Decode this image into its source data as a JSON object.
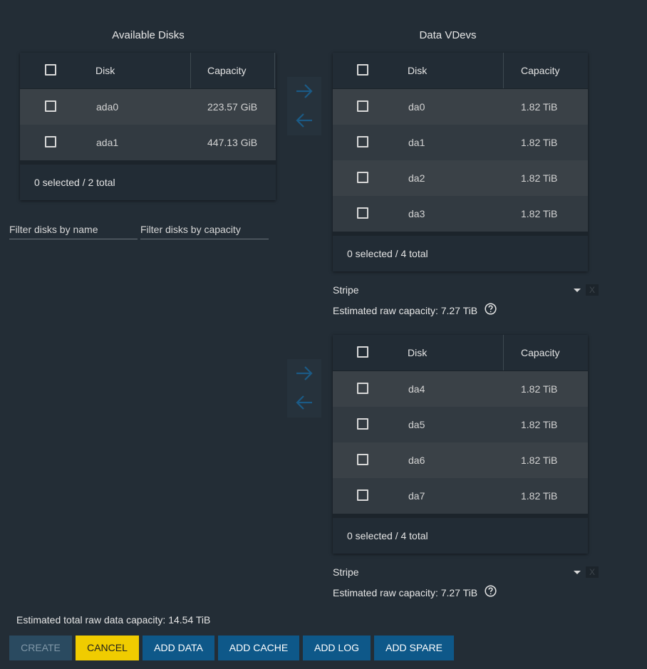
{
  "available": {
    "title": "Available Disks",
    "headers": {
      "disk": "Disk",
      "capacity": "Capacity"
    },
    "rows": [
      {
        "disk": "ada0",
        "capacity": "223.57 GiB"
      },
      {
        "disk": "ada1",
        "capacity": "447.13 GiB"
      }
    ],
    "footer": "0 selected / 2 total",
    "filter_name_placeholder": "Filter disks by name",
    "filter_capacity_placeholder": "Filter disks by capacity"
  },
  "data_vdevs": {
    "title": "Data VDevs",
    "vdevs": [
      {
        "headers": {
          "disk": "Disk",
          "capacity": "Capacity"
        },
        "rows": [
          {
            "disk": "da0",
            "capacity": "1.82 TiB"
          },
          {
            "disk": "da1",
            "capacity": "1.82 TiB"
          },
          {
            "disk": "da2",
            "capacity": "1.82 TiB"
          },
          {
            "disk": "da3",
            "capacity": "1.82 TiB"
          }
        ],
        "footer": "0 selected / 4 total",
        "layout": "Stripe",
        "remove_label": "X",
        "estimated": "Estimated raw capacity: 7.27 TiB"
      },
      {
        "headers": {
          "disk": "Disk",
          "capacity": "Capacity"
        },
        "rows": [
          {
            "disk": "da4",
            "capacity": "1.82 TiB"
          },
          {
            "disk": "da5",
            "capacity": "1.82 TiB"
          },
          {
            "disk": "da6",
            "capacity": "1.82 TiB"
          },
          {
            "disk": "da7",
            "capacity": "1.82 TiB"
          }
        ],
        "footer": "0 selected / 4 total",
        "layout": "Stripe",
        "remove_label": "X",
        "estimated": "Estimated raw capacity: 7.27 TiB"
      }
    ]
  },
  "total_estimated": "Estimated total raw data capacity: 14.54 TiB",
  "buttons": {
    "create": "CREATE",
    "cancel": "CANCEL",
    "add_data": "ADD DATA",
    "add_cache": "ADD CACHE",
    "add_log": "ADD LOG",
    "add_spare": "ADD SPARE"
  },
  "icons": {
    "move_right": "arrow-right-icon",
    "move_left": "arrow-left-icon",
    "help": "help-circle-icon",
    "dropdown": "chevron-down-icon"
  },
  "colors": {
    "background": "#232d36",
    "primary_button": "#0e5889",
    "cancel_button": "#f0cc00",
    "disabled_button": "#2a4a60",
    "arrow": "#1b5a85"
  }
}
